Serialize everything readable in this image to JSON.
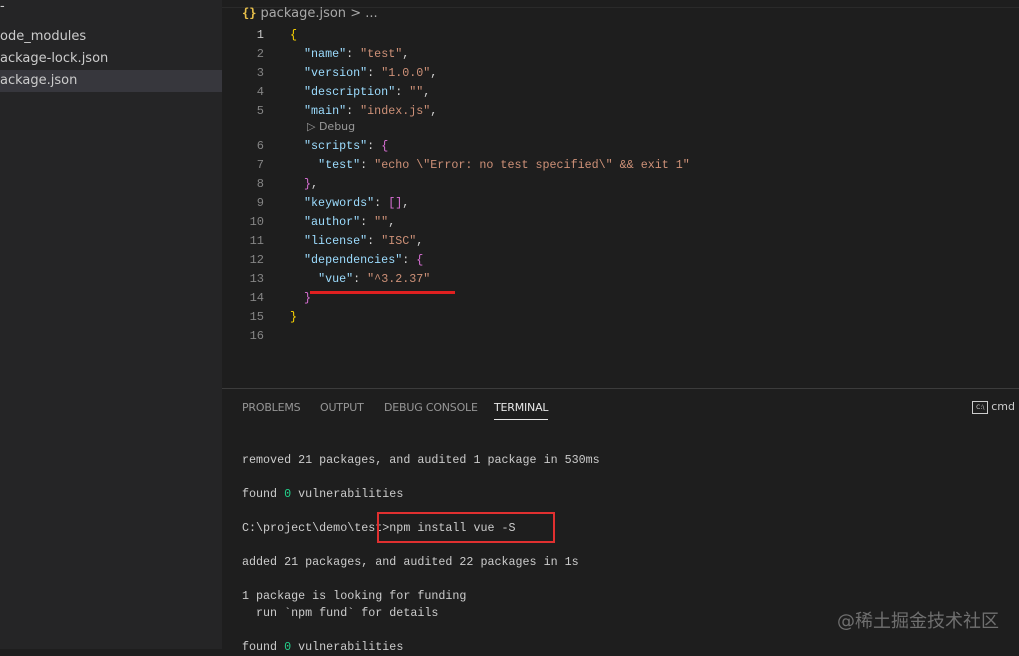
{
  "sidebar": {
    "items": [
      {
        "label": "-"
      },
      {
        "label": "ode_modules"
      },
      {
        "label": "ackage-lock.json"
      },
      {
        "label": "ackage.json"
      }
    ]
  },
  "editor": {
    "breadcrumb": {
      "icon": "{}",
      "file": "package.json",
      "rest": "> ..."
    },
    "codelens": "▷ Debug",
    "lines": [
      [
        [
          "{",
          "#ffd700"
        ]
      ],
      [
        [
          "  ",
          ""
        ],
        [
          "\"name\"",
          "#9cdcfe"
        ],
        [
          ": ",
          ""
        ],
        [
          "\"test\"",
          "#ce9178"
        ],
        [
          ",",
          ""
        ]
      ],
      [
        [
          "  ",
          ""
        ],
        [
          "\"version\"",
          "#9cdcfe"
        ],
        [
          ": ",
          ""
        ],
        [
          "\"1.0.0\"",
          "#ce9178"
        ],
        [
          ",",
          ""
        ]
      ],
      [
        [
          "  ",
          ""
        ],
        [
          "\"description\"",
          "#9cdcfe"
        ],
        [
          ": ",
          ""
        ],
        [
          "\"\"",
          "#ce9178"
        ],
        [
          ",",
          ""
        ]
      ],
      [
        [
          "  ",
          ""
        ],
        [
          "\"main\"",
          "#9cdcfe"
        ],
        [
          ": ",
          ""
        ],
        [
          "\"index.js\"",
          "#ce9178"
        ],
        [
          ",",
          ""
        ]
      ],
      [
        [
          "  ",
          ""
        ],
        [
          "\"scripts\"",
          "#9cdcfe"
        ],
        [
          ": ",
          ""
        ],
        [
          "{",
          "#da70d6"
        ]
      ],
      [
        [
          "    ",
          ""
        ],
        [
          "\"test\"",
          "#9cdcfe"
        ],
        [
          ": ",
          ""
        ],
        [
          "\"echo \\\"Error: no test specified\\\" && exit 1\"",
          "#ce9178"
        ]
      ],
      [
        [
          "  ",
          ""
        ],
        [
          "}",
          "#da70d6"
        ],
        [
          ",",
          ""
        ]
      ],
      [
        [
          "  ",
          ""
        ],
        [
          "\"keywords\"",
          "#9cdcfe"
        ],
        [
          ": ",
          ""
        ],
        [
          "[]",
          "#da70d6"
        ],
        [
          ",",
          ""
        ]
      ],
      [
        [
          "  ",
          ""
        ],
        [
          "\"author\"",
          "#9cdcfe"
        ],
        [
          ": ",
          ""
        ],
        [
          "\"\"",
          "#ce9178"
        ],
        [
          ",",
          ""
        ]
      ],
      [
        [
          "  ",
          ""
        ],
        [
          "\"license\"",
          "#9cdcfe"
        ],
        [
          ": ",
          ""
        ],
        [
          "\"ISC\"",
          "#ce9178"
        ],
        [
          ",",
          ""
        ]
      ],
      [
        [
          "  ",
          ""
        ],
        [
          "\"dependencies\"",
          "#9cdcfe"
        ],
        [
          ": ",
          ""
        ],
        [
          "{",
          "#da70d6"
        ]
      ],
      [
        [
          "    ",
          ""
        ],
        [
          "\"vue\"",
          "#9cdcfe"
        ],
        [
          ": ",
          ""
        ],
        [
          "\"^3.2.37\"",
          "#ce9178"
        ]
      ],
      [
        [
          "  ",
          ""
        ],
        [
          "}",
          "#da70d6"
        ]
      ],
      [
        [
          "}",
          "#ffd700"
        ]
      ],
      []
    ]
  },
  "panel": {
    "tabs": [
      "PROBLEMS",
      "OUTPUT",
      "DEBUG CONSOLE",
      "TERMINAL"
    ],
    "shell": "cmd",
    "shell_icon": "C:\\"
  },
  "terminal": {
    "l1": "removed 21 packages, and audited 1 package in 530ms",
    "l2a": "found ",
    "l2b": "0",
    "l2c": " vulnerabilities",
    "l3": "C:\\project\\demo\\test>npm install vue -S",
    "l4": "added 21 packages, and audited 22 packages in 1s",
    "l5": "1 package is looking for funding",
    "l6": "  run `npm fund` for details",
    "l7a": "found ",
    "l7b": "0",
    "l7c": " vulnerabilities"
  },
  "watermark": "@稀土掘金技术社区"
}
